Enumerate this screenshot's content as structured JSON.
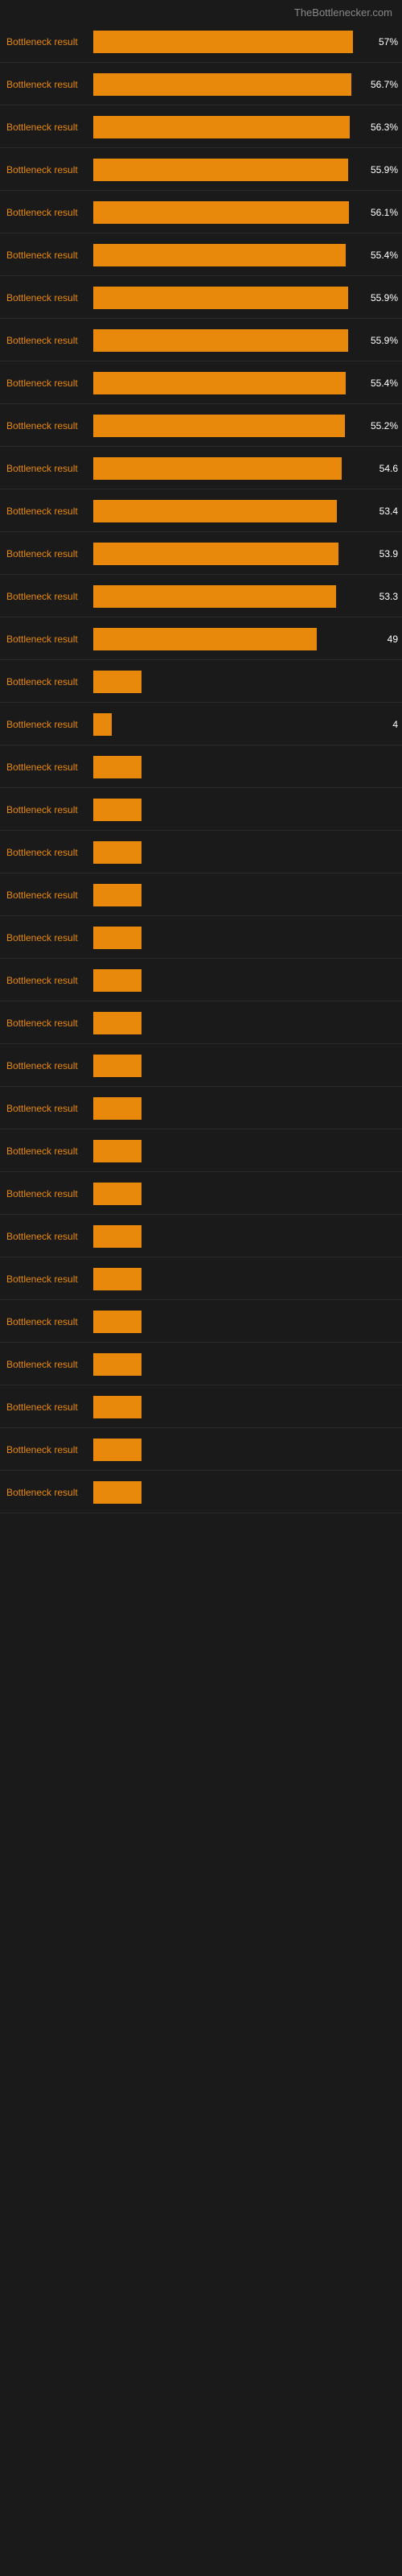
{
  "header": {
    "title": "TheBottlenecker.com"
  },
  "bars": [
    {
      "label": "Bottleneck result",
      "value": 57.0,
      "display": "57%",
      "maxWidth": 200
    },
    {
      "label": "Bottleneck result",
      "value": 56.7,
      "display": "56.7%",
      "maxWidth": 200
    },
    {
      "label": "Bottleneck result",
      "value": 56.3,
      "display": "56.3%",
      "maxWidth": 200
    },
    {
      "label": "Bottleneck result",
      "value": 55.9,
      "display": "55.9%",
      "maxWidth": 200
    },
    {
      "label": "Bottleneck result",
      "value": 56.1,
      "display": "56.1%",
      "maxWidth": 200
    },
    {
      "label": "Bottleneck result",
      "value": 55.4,
      "display": "55.4%",
      "maxWidth": 200
    },
    {
      "label": "Bottleneck result",
      "value": 55.9,
      "display": "55.9%",
      "maxWidth": 200
    },
    {
      "label": "Bottleneck result",
      "value": 55.9,
      "display": "55.9%",
      "maxWidth": 200
    },
    {
      "label": "Bottleneck result",
      "value": 55.4,
      "display": "55.4%",
      "maxWidth": 200
    },
    {
      "label": "Bottleneck result",
      "value": 55.2,
      "display": "55.2%",
      "maxWidth": 200
    },
    {
      "label": "Bottleneck result",
      "value": 54.6,
      "display": "54.6",
      "maxWidth": 200
    },
    {
      "label": "Bottleneck result",
      "value": 53.4,
      "display": "53.4",
      "maxWidth": 200
    },
    {
      "label": "Bottleneck result",
      "value": 53.9,
      "display": "53.9",
      "maxWidth": 200
    },
    {
      "label": "Bottleneck result",
      "value": 53.3,
      "display": "53.3",
      "maxWidth": 200
    },
    {
      "label": "Bottleneck result",
      "value": 49.0,
      "display": "49",
      "maxWidth": 200
    },
    {
      "label": "Bottleneck result",
      "value": 0,
      "display": "",
      "maxWidth": 200
    },
    {
      "label": "Bottleneck result",
      "value": 4.0,
      "display": "4",
      "maxWidth": 200
    },
    {
      "label": "Bottleneck result",
      "value": 0,
      "display": "",
      "maxWidth": 200
    },
    {
      "label": "Bottleneck result",
      "value": 0,
      "display": "",
      "maxWidth": 200
    },
    {
      "label": "Bottleneck result",
      "value": 0,
      "display": "",
      "maxWidth": 200
    },
    {
      "label": "Bottleneck result",
      "value": 0,
      "display": "",
      "maxWidth": 200
    },
    {
      "label": "Bottleneck result",
      "value": 0,
      "display": "",
      "maxWidth": 200
    },
    {
      "label": "Bottleneck result",
      "value": 0,
      "display": "",
      "maxWidth": 200
    },
    {
      "label": "Bottleneck result",
      "value": 0,
      "display": "",
      "maxWidth": 200
    },
    {
      "label": "Bottleneck result",
      "value": 0,
      "display": "",
      "maxWidth": 200
    },
    {
      "label": "Bottleneck result",
      "value": 0,
      "display": "",
      "maxWidth": 200
    },
    {
      "label": "Bottleneck result",
      "value": 0,
      "display": "",
      "maxWidth": 200
    },
    {
      "label": "Bottleneck result",
      "value": 0,
      "display": "",
      "maxWidth": 200
    },
    {
      "label": "Bottleneck result",
      "value": 0,
      "display": "",
      "maxWidth": 200
    },
    {
      "label": "Bottleneck result",
      "value": 0,
      "display": "",
      "maxWidth": 200
    },
    {
      "label": "Bottleneck result",
      "value": 0,
      "display": "",
      "maxWidth": 200
    },
    {
      "label": "Bottleneck result",
      "value": 0,
      "display": "",
      "maxWidth": 200
    },
    {
      "label": "Bottleneck result",
      "value": 0,
      "display": "",
      "maxWidth": 200
    },
    {
      "label": "Bottleneck result",
      "value": 0,
      "display": "",
      "maxWidth": 200
    },
    {
      "label": "Bottleneck result",
      "value": 0,
      "display": "",
      "maxWidth": 200
    }
  ],
  "accent_color": "#e8890c",
  "bar_max_value": 57.0
}
